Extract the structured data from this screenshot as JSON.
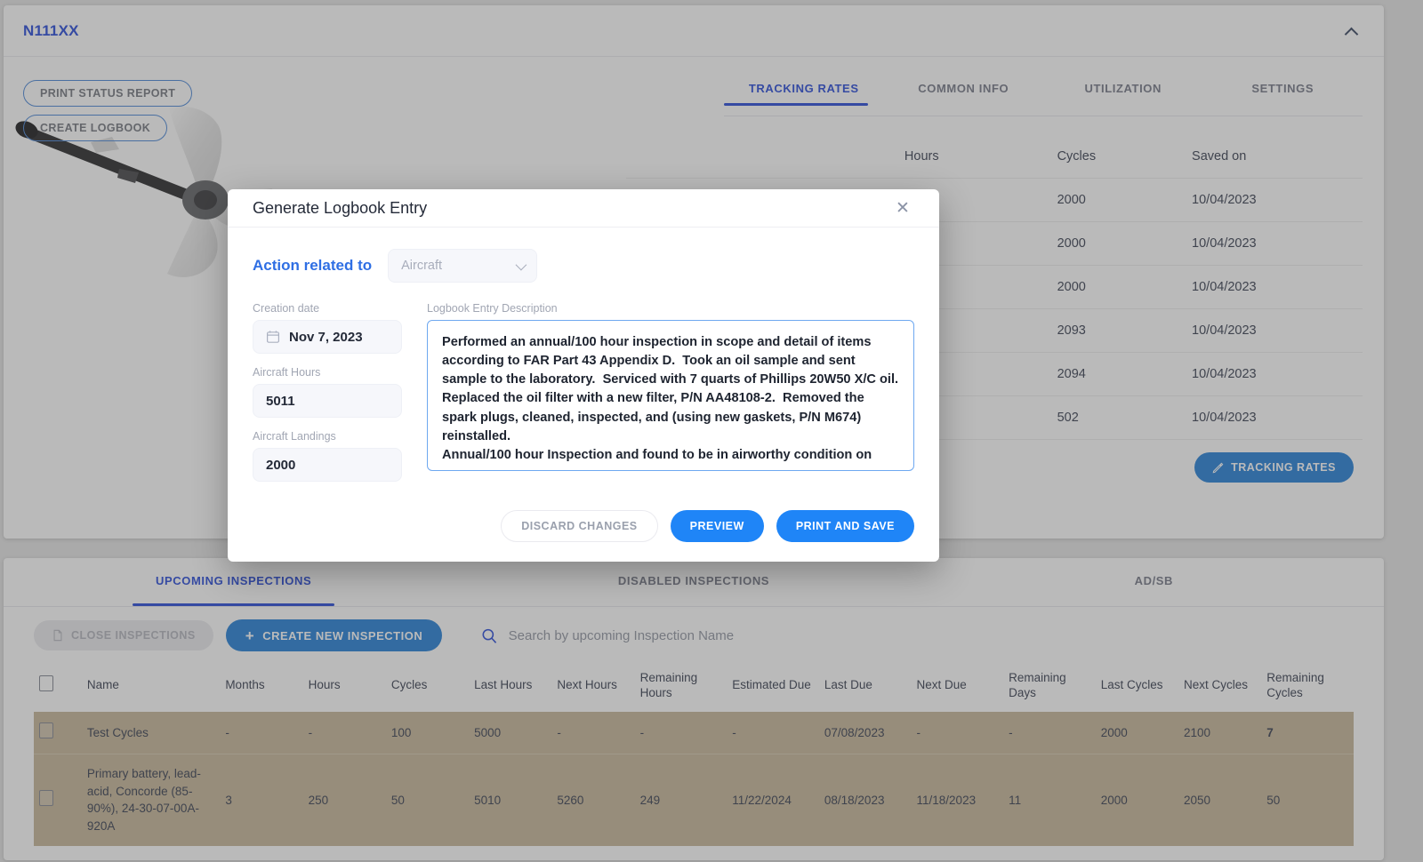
{
  "header": {
    "tail_number": "N111XX",
    "collapse_icon": "chevron-up-icon"
  },
  "left_actions": {
    "print_status_report": "PRINT STATUS REPORT",
    "create_logbook": "CREATE LOGBOOK"
  },
  "upper_tabs": [
    {
      "label": "TRACKING RATES",
      "active": true
    },
    {
      "label": "COMMON INFO",
      "active": false
    },
    {
      "label": "UTILIZATION",
      "active": false
    },
    {
      "label": "SETTINGS",
      "active": false
    }
  ],
  "rates_table": {
    "columns": [
      "",
      "Hours",
      "Cycles",
      "Saved on"
    ],
    "rows": [
      {
        "name": "",
        "hours": "",
        "cycles": "2000",
        "saved_on": "10/04/2023"
      },
      {
        "name": "",
        "hours": "",
        "cycles": "2000",
        "saved_on": "10/04/2023"
      },
      {
        "name": "",
        "hours": "",
        "cycles": "2000",
        "saved_on": "10/04/2023"
      },
      {
        "name": "",
        "hours": "",
        "cycles": "2093",
        "saved_on": "10/04/2023"
      },
      {
        "name": "",
        "hours": "",
        "cycles": "2094",
        "saved_on": "10/04/2023"
      },
      {
        "name": "",
        "hours": "",
        "cycles": "502",
        "saved_on": "10/04/2023"
      }
    ],
    "edit_button": "TRACKING RATES",
    "edit_icon": "pencil-icon"
  },
  "lower_tabs": [
    {
      "label": "UPCOMING INSPECTIONS",
      "active": true
    },
    {
      "label": "DISABLED INSPECTIONS",
      "active": false
    },
    {
      "label": "AD/SB",
      "active": false
    }
  ],
  "lower_toolbar": {
    "close_inspections": "CLOSE INSPECTIONS",
    "close_inspections_icon": "document-icon",
    "create_new_inspection": "CREATE NEW INSPECTION",
    "create_icon": "plus-icon",
    "search_icon": "search-icon",
    "search_placeholder": "Search by upcoming Inspection Name",
    "search_value": ""
  },
  "inspections_table": {
    "columns": [
      "",
      "Name",
      "Months",
      "Hours",
      "Cycles",
      "Last Hours",
      "Next Hours",
      "Remaining Hours",
      "Estimated Due",
      "Last Due",
      "Next Due",
      "Remaining Days",
      "Last Cycles",
      "Next Cycles",
      "Remaining Cycles"
    ],
    "rows": [
      {
        "name": "Test Cycles",
        "months": "-",
        "hours": "-",
        "cycles": "100",
        "last_hours": "5000",
        "next_hours": "-",
        "remaining_hours": "-",
        "estimated_due": "-",
        "last_due": "07/08/2023",
        "next_due": "-",
        "remaining_days": "-",
        "last_cycles": "2000",
        "next_cycles": "2100",
        "remaining_cycles": "7",
        "remaining_cycles_bold": true
      },
      {
        "name": "Primary battery, lead-acid, Concorde (85-90%), 24-30-07-00A-920A",
        "months": "3",
        "hours": "250",
        "cycles": "50",
        "last_hours": "5010",
        "next_hours": "5260",
        "remaining_hours": "249",
        "estimated_due": "11/22/2024",
        "last_due": "08/18/2023",
        "next_due": "11/18/2023",
        "remaining_days": "11",
        "last_cycles": "2000",
        "next_cycles": "2050",
        "remaining_cycles": "50",
        "remaining_cycles_bold": false
      }
    ]
  },
  "modal": {
    "title": "Generate Logbook Entry",
    "close_icon": "close-icon",
    "action_label": "Action related to",
    "action_select_value": "Aircraft",
    "action_select_chevron": "chevron-down-icon",
    "creation_date_label": "Creation date",
    "creation_date_icon": "calendar-icon",
    "creation_date_value": "Nov 7, 2023",
    "aircraft_hours_label": "Aircraft Hours",
    "aircraft_hours_value": "5011",
    "aircraft_landings_label": "Aircraft Landings",
    "aircraft_landings_value": "2000",
    "description_label": "Logbook Entry Description",
    "description_value": "Performed an annual/100 hour inspection in scope and detail of items according to FAR Part 43 Appendix D.  Took an oil sample and sent sample to the laboratory.  Serviced with 7 quarts of Phillips 20W50 X/C oil.  Replaced the oil filter with a new filter, P/N AA48108-2.  Removed the spark plugs, cleaned, inspected, and (using new gaskets, P/N M674) reinstalled.\nAnnual/100 hour Inspection and found to be in airworthy condition on",
    "discard_label": "DISCARD CHANGES",
    "preview_label": "PREVIEW",
    "print_save_label": "PRINT AND SAVE"
  },
  "colors": {
    "accent_blue": "#1a3fd6",
    "primary_blue": "#1878d4",
    "modal_blue": "#1f85f7",
    "row_highlight": "#c3b293"
  }
}
